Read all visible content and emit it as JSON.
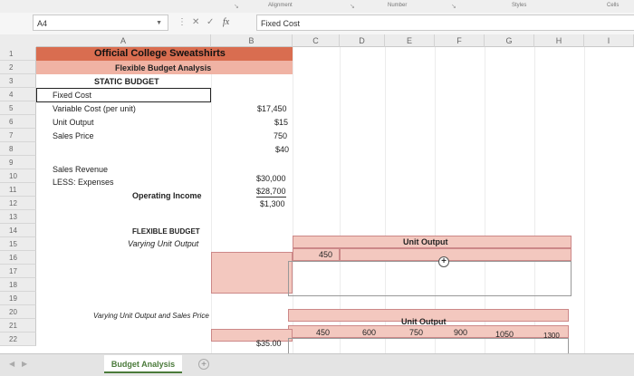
{
  "ribbon": {
    "alignment": "Alignment",
    "number": "Number",
    "styles": "Styles",
    "cells": "Cells"
  },
  "formula_bar": {
    "name_box": "A4",
    "cancel": "✕",
    "enter": "✓",
    "fx": "fx",
    "content": "Fixed Cost"
  },
  "columns": [
    "A",
    "B",
    "C",
    "D",
    "E",
    "F",
    "G",
    "H",
    "I"
  ],
  "rows": [
    "1",
    "2",
    "3",
    "4",
    "5",
    "6",
    "7",
    "8",
    "9",
    "10",
    "11",
    "12",
    "13",
    "14",
    "15",
    "16",
    "17",
    "18",
    "19",
    "20",
    "21",
    "22"
  ],
  "sheet": {
    "title": "Official College Sweatshirts",
    "subtitle": "Flexible Budget Analysis",
    "static_budget": "STATIC BUDGET",
    "fixed_cost_label": "Fixed Cost",
    "variable_cost_label": "Variable Cost (per unit)",
    "unit_output_label": "Unit Output",
    "sales_price_label": "Sales Price",
    "fixed_cost_value": "$17,450",
    "variable_cost_value": "$15",
    "unit_output_value": "750",
    "sales_price_value": "$40",
    "sales_revenue_label": "Sales Revenue",
    "less_expenses_label": "LESS: Expenses",
    "operating_income_label": "Operating Income",
    "sales_revenue_value": "$30,000",
    "expenses_value": "$28,700",
    "operating_income_value": "$1,300",
    "flexible_budget": "FLEXIBLE BUDGET",
    "varying_unit_output": "Varying Unit Output",
    "unit_output_header": "Unit Output",
    "flex_c14": "450",
    "varying_both": "Varying Unit Output and Sales Price",
    "unit_output_header2": "Unit Output",
    "c21": "450",
    "d21": "600",
    "e21": "750",
    "f21": "900",
    "g21": "1050",
    "h21": "1300",
    "b22": "$35.00"
  },
  "sheet_tab": "Budget Analysis",
  "add_sheet": "+"
}
